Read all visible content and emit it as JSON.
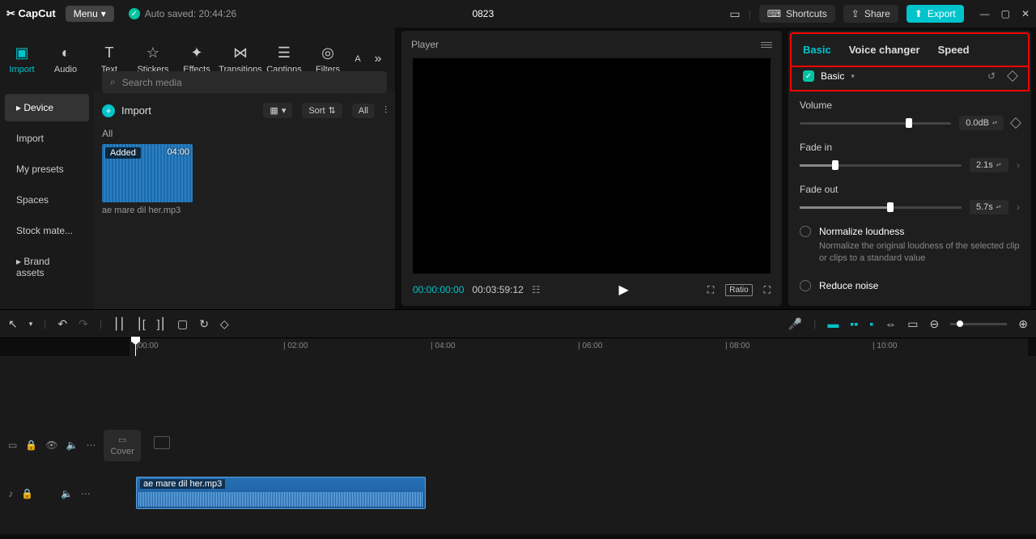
{
  "titlebar": {
    "logo": "✂ CapCut",
    "menu": "Menu",
    "autosave": "Auto saved: 20:44:26",
    "project": "0823",
    "shortcuts": "Shortcuts",
    "share": "Share",
    "export": "Export"
  },
  "tools": {
    "import": "Import",
    "audio": "Audio",
    "text": "Text",
    "stickers": "Stickers",
    "effects": "Effects",
    "transitions": "Transitions",
    "captions": "Captions",
    "filters": "Filters",
    "a": "A"
  },
  "sidebar": {
    "device": "Device",
    "import": "Import",
    "presets": "My presets",
    "spaces": "Spaces",
    "stock": "Stock mate...",
    "brand": "Brand assets"
  },
  "media": {
    "search_ph": "Search media",
    "import": "Import",
    "sort": "Sort",
    "all_btn": "All",
    "all_label": "All",
    "thumb_badge": "Added",
    "thumb_dur": "04:00",
    "thumb_name": "ae mare dil her.mp3"
  },
  "player": {
    "title": "Player",
    "cur": "00:00:00:00",
    "dur": "00:03:59:12",
    "ratio": "Ratio"
  },
  "props": {
    "tab_basic": "Basic",
    "tab_voice": "Voice changer",
    "tab_speed": "Speed",
    "section": "Basic",
    "volume": "Volume",
    "volume_val": "0.0dB",
    "fadein": "Fade in",
    "fadein_val": "2.1s",
    "fadeout": "Fade out",
    "fadeout_val": "5.7s",
    "normalize": "Normalize loudness",
    "normalize_desc": "Normalize the original loudness of the selected clip or clips to a standard value",
    "reduce": "Reduce noise"
  },
  "timeline": {
    "cover": "Cover",
    "clip_name": "ae mare dil her.mp3",
    "ticks": [
      "|00:00",
      "| 02:00",
      "| 04:00",
      "| 06:00",
      "| 08:00",
      "| 10:00"
    ]
  }
}
